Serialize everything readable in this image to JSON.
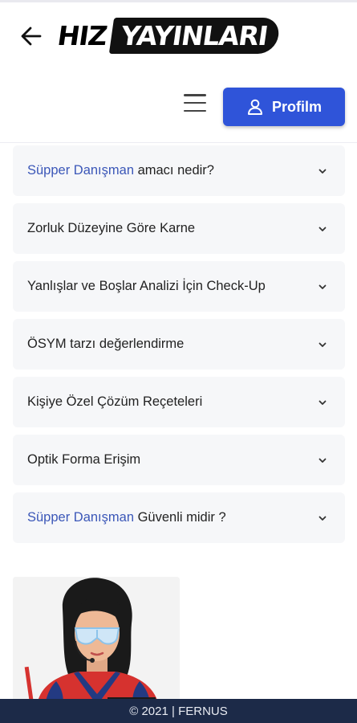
{
  "header": {
    "logo_part1": "HIZ",
    "logo_part2": "YAYINLARI",
    "profile_label": "Profilm"
  },
  "faq": {
    "items": [
      {
        "highlight": "Süpper Danışman",
        "text": " amacı nedir?"
      },
      {
        "highlight": "",
        "text": "Zorluk Düzeyine Göre Karne"
      },
      {
        "highlight": "",
        "text": "Yanlışlar ve Boşlar Analizi İçin Check-Up"
      },
      {
        "highlight": "",
        "text": "ÖSYM tarzı değerlendirme"
      },
      {
        "highlight": "",
        "text": "Kişiye Özel Çözüm Reçeteleri"
      },
      {
        "highlight": "",
        "text": "Optik Forma Erişim"
      },
      {
        "highlight": "Süpper Danışman",
        "text": " Güvenli midir ?"
      }
    ]
  },
  "footer": {
    "text": "© 2021 | FERNUS"
  },
  "colors": {
    "accent": "#2f54d9",
    "highlight": "#3b57b8",
    "footer_bg": "#1c2a48"
  },
  "icons": [
    "arrow-left-icon",
    "hamburger-menu-icon",
    "user-icon",
    "chevron-down-icon"
  ]
}
